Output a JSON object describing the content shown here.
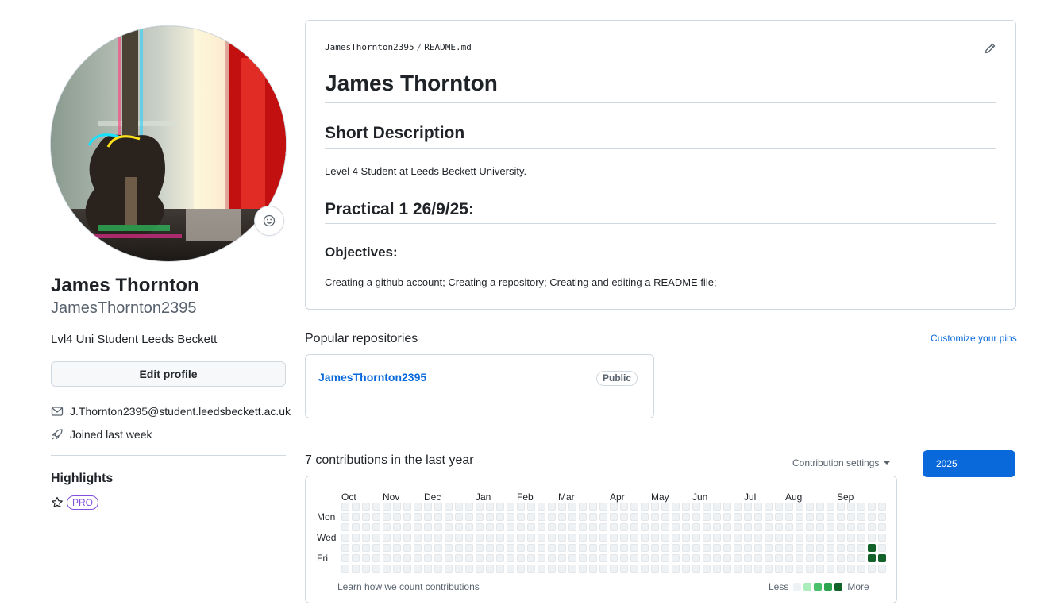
{
  "profile": {
    "display_name": "James Thornton",
    "username": "JamesThornton2395",
    "bio": "Lvl4 Uni Student Leeds Beckett",
    "edit_profile_label": "Edit profile",
    "email": "J.Thornton2395@student.leedsbeckett.ac.uk",
    "joined": "Joined last week",
    "highlights_title": "Highlights",
    "pro_badge": "PRO"
  },
  "readme": {
    "path_user": "JamesThornton2395",
    "path_sep": "/",
    "path_file": "README.md",
    "h1": "James Thornton",
    "section1_title": "Short Description",
    "section1_text": "Level 4 Student at Leeds Beckett University.",
    "section2_title": "Practical 1 26/9/25:",
    "objectives_title": "Objectives:",
    "objectives_text": "Creating a github account; Creating a repository; Creating and editing a README file;"
  },
  "popular": {
    "title": "Popular repositories",
    "customize_label": "Customize your pins",
    "repos": [
      {
        "name": "JamesThornton2395",
        "visibility": "Public"
      }
    ]
  },
  "contributions": {
    "title": "7 contributions in the last year",
    "settings_label": "Contribution settings",
    "year_button": "2025",
    "months": [
      "Oct",
      "Nov",
      "Dec",
      "Jan",
      "Feb",
      "Mar",
      "Apr",
      "May",
      "Jun",
      "Jul",
      "Aug",
      "Sep"
    ],
    "day_labels": [
      "Mon",
      "Wed",
      "Fri"
    ],
    "learn_label": "Learn how we count contributions",
    "legend_less": "Less",
    "legend_more": "More",
    "level_colors": [
      "#eff2f5",
      "#aceebb",
      "#4ac26b",
      "#2da44e",
      "#116329"
    ],
    "weeks": 53,
    "active_cells": [
      {
        "week": 51,
        "day": 4,
        "level": 4
      },
      {
        "week": 51,
        "day": 5,
        "level": 4
      },
      {
        "week": 52,
        "day": 5,
        "level": 4
      }
    ]
  },
  "colors": {
    "accent": "#0969da",
    "pro": "#8250df"
  }
}
